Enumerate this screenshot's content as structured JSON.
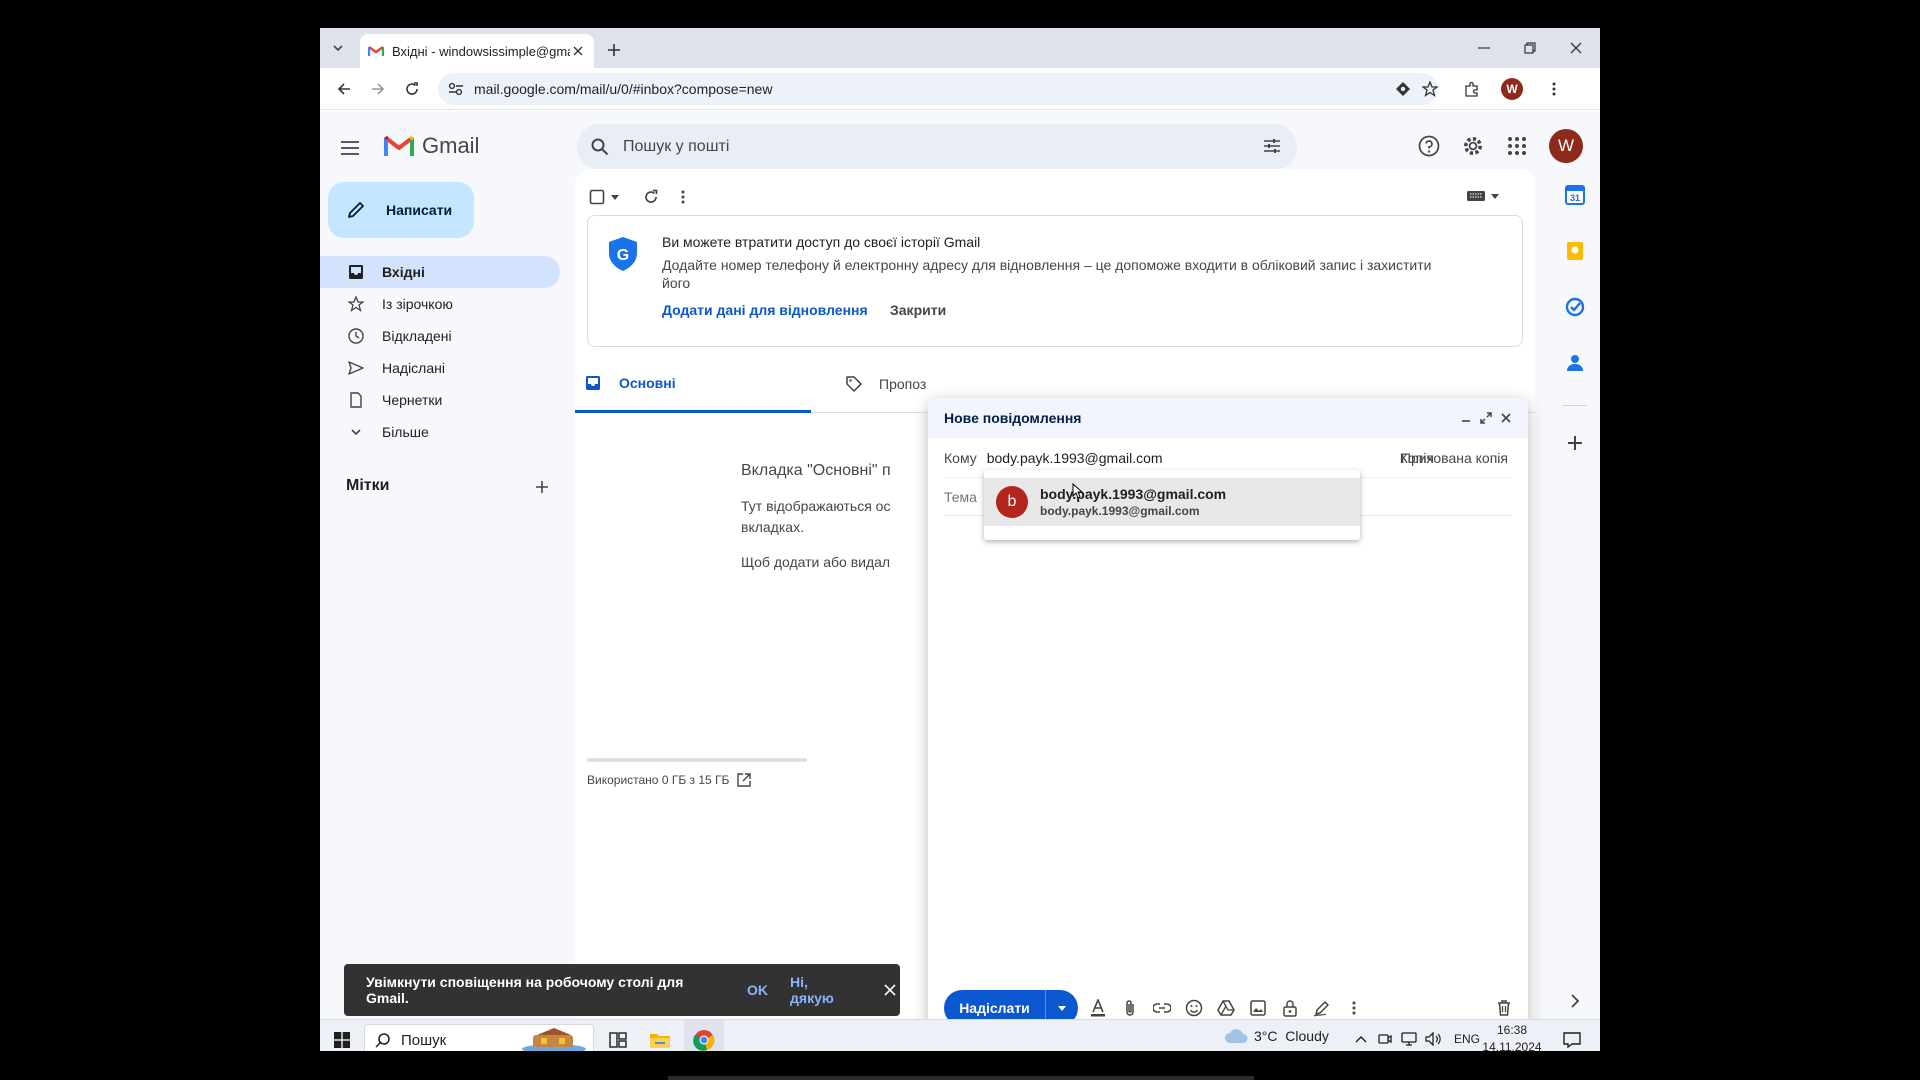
{
  "browser": {
    "tab_title": "Вхідні - windowsissimple@gmail.com",
    "url": "mail.google.com/mail/u/0/#inbox?compose=new",
    "profile_initial": "W"
  },
  "gmail": {
    "logo_text": "Gmail",
    "search_placeholder": "Пошук у пошті",
    "avatar": "W",
    "compose_label": "Написати",
    "nav": [
      {
        "label": "Вхідні"
      },
      {
        "label": "Із зірочкою"
      },
      {
        "label": "Відкладені"
      },
      {
        "label": "Надіслані"
      },
      {
        "label": "Чернетки"
      },
      {
        "label": "Більше"
      }
    ],
    "labels_header": "Мітки",
    "banner": {
      "title": "Ви можете втратити доступ до своєї історії Gmail",
      "body": "Додайте номер телефону й електронну адресу для відновлення – це допоможе входити в обліковий запис і захистити його",
      "action": "Додати дані для відновлення",
      "dismiss": "Закрити"
    },
    "tabs": [
      {
        "label": "Основні"
      },
      {
        "label": "Пропоз"
      }
    ],
    "empty": {
      "title": "Вкладка \"Основні\" п",
      "line1": "Тут відображаються ос",
      "line2": "вкладках.",
      "line3": "Щоб додати або видал"
    },
    "storage": "Використано 0 ГБ з 15 ГБ",
    "storage_fraction": 0,
    "stray_char": "У",
    "snackbar": {
      "text": "Увімкнути сповіщення на робочому столі для Gmail.",
      "ok": "OK",
      "no": "Ні, дякую"
    }
  },
  "compose": {
    "title": "Нове повідомлення",
    "to_label": "Кому",
    "to_value": "body.payk.1993@gmail.com",
    "cc": "Копія",
    "bcc": "Прихована копія",
    "subject_placeholder": "Тема",
    "suggestion": {
      "initial": "b",
      "name": "body.payk.1993@gmail.com",
      "email": "body.payk.1993@gmail.com"
    },
    "send_label": "Надіслати"
  },
  "taskbar": {
    "search": "Пошук",
    "weather": "3°C  Cloudy",
    "lang": "ENG",
    "time": "16:38",
    "date": "14.11.2024"
  },
  "colors": {
    "accent": "#0b57d0",
    "compose_button": "#c2e7ff",
    "active_nav": "#d3e3fd",
    "avatar": "#8e2a1b"
  }
}
